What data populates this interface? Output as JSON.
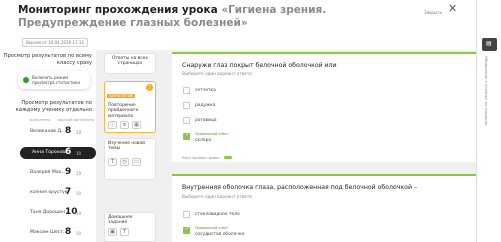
{
  "header": {
    "title_main": "Мониторинг прохождения урока",
    "title_accent": "«Гигиена зрения. Предупреждение глазных болезней»",
    "version": "Версия от 10.04.2020 17:13",
    "close_label": "Закрыть"
  },
  "left": {
    "section_all": "Просмотр результатов по всему классу сразу",
    "toggle_label": "Включить режим просмотра статистики",
    "section_each": "Просмотр результатов по каждому ученику отдельно",
    "col_done": "выполнено",
    "col_total": "заданий выполнено",
    "students": [
      {
        "name": "Великанов Д...",
        "score": "8",
        "max": "10",
        "active": false
      },
      {
        "name": "Анна Торохова",
        "score": "6",
        "max": "10",
        "active": true
      },
      {
        "name": "Валерия Мах...",
        "score": "9",
        "max": "10",
        "active": false
      },
      {
        "name": "ксения орустук",
        "score": "7",
        "max": "10",
        "active": false
      },
      {
        "name": "Таня Дорошен...",
        "score": "10",
        "max": "10",
        "active": false
      },
      {
        "name": "Максим Шест...",
        "score": "8",
        "max": "10",
        "active": false
      }
    ]
  },
  "steps": {
    "all_pages": "Ответы на всех страницах",
    "badge": "ЗАКРЕПЛЕНИЕ",
    "badge_count": "5",
    "repeat": "Повторение пройденного материала",
    "new_topic": "Изучение новой темы",
    "homework": "Домашнее задание"
  },
  "questions": [
    {
      "title": "Снаружи глаз покрыт белочной оболочкой или",
      "hint": "Выберите один вариант ответа",
      "options": [
        "сетчатка",
        "радужка",
        "роговица"
      ],
      "correct_label": "Правильный ответ",
      "correct_answer": "склера",
      "time_label": "Ельсі пройден время"
    },
    {
      "title": "Внутренняя  оболочка глаза, расположенная под белочной оболочкой –",
      "hint": "Выберите один вариант ответа",
      "options": [
        "стекловидное тело"
      ],
      "correct_label": "Правильный ответ",
      "correct_answer": "сосудистая оболочка"
    }
  ],
  "rail": {
    "comments_label": "Обращение к ученику по заданию"
  },
  "colors": {
    "accent_green": "#8dc63f",
    "badge_orange": "#f4a623",
    "dark": "#222222"
  }
}
